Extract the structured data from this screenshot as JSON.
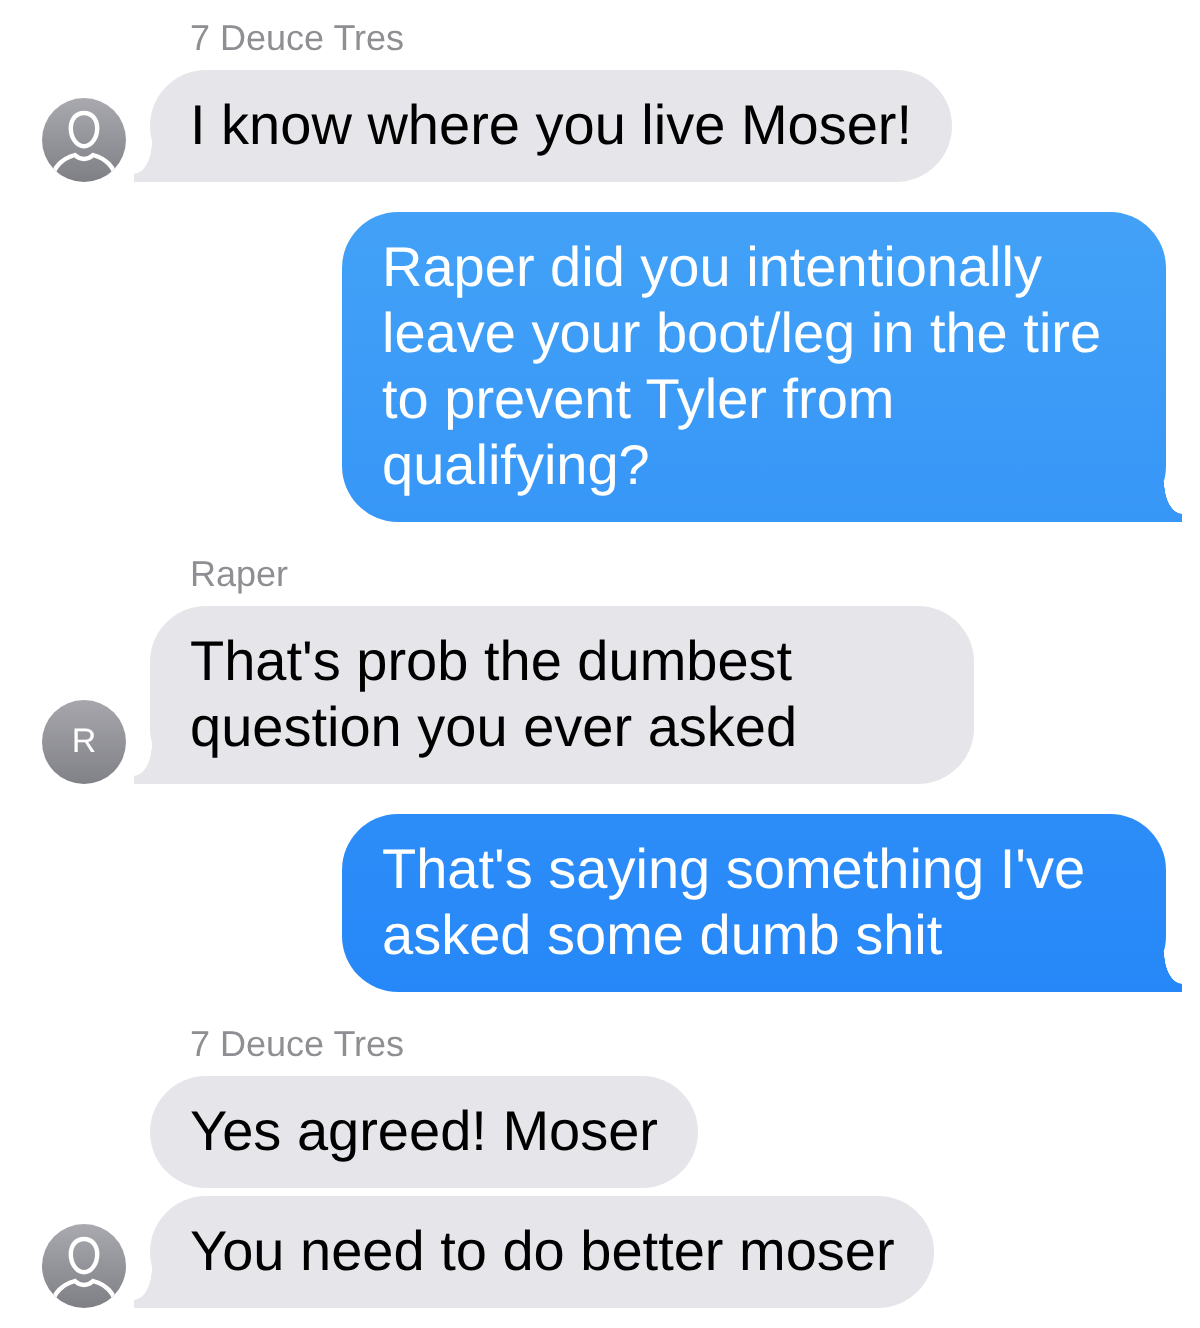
{
  "messages": [
    {
      "kind": "incoming",
      "sender": "7 Deuce Tres",
      "text": "I know where you live Moser!",
      "tail": true,
      "avatar": {
        "kind": "silhouette"
      }
    },
    {
      "kind": "outgoing",
      "text": "Raper did you intentionally leave your boot/leg in the tire to prevent Tyler from qualifying?",
      "tail": true
    },
    {
      "kind": "incoming",
      "sender": "Raper",
      "text": "That's prob the dumbest question you ever asked",
      "tail": true,
      "avatar": {
        "kind": "initial",
        "text": "R"
      }
    },
    {
      "kind": "outgoing",
      "text": "That's saying something I've asked some dumb shit",
      "tail": true
    },
    {
      "kind": "incoming",
      "sender": "7 Deuce Tres",
      "text": "Yes agreed! Moser",
      "tail": false
    },
    {
      "kind": "incoming",
      "text": "You need to do better moser",
      "tail": true,
      "avatar": {
        "kind": "silhouette"
      }
    }
  ]
}
